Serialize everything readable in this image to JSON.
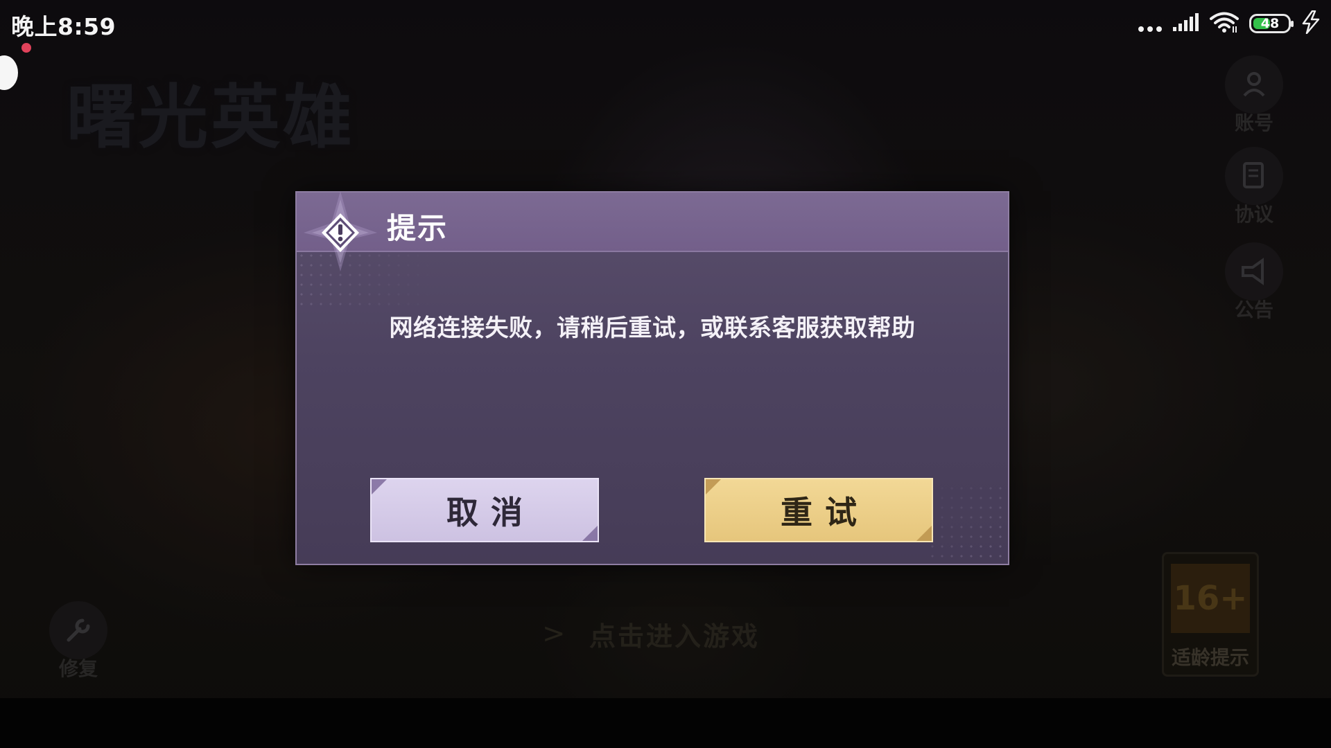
{
  "status_bar": {
    "time": "晚上8:59",
    "battery_level": "48",
    "battery_fraction": 0.48,
    "charging": true,
    "icons": [
      "more-dots-icon",
      "signal-icon",
      "wifi-icon",
      "battery-icon",
      "charging-bolt-icon"
    ]
  },
  "background": {
    "game_logo": "曙光英雄",
    "side_buttons": {
      "account": "账号",
      "agreement": "协议",
      "notice": "公告",
      "repair": "修复"
    },
    "enter_game": "点击进入游戏",
    "enter_arrow": ">",
    "age_rating": {
      "value": "16+",
      "label": "适龄提示"
    }
  },
  "dialog": {
    "title": "提示",
    "message": "网络连接失败，请稍后重试，或联系客服获取帮助",
    "buttons": {
      "cancel": "取消",
      "retry": "重试"
    }
  },
  "colors": {
    "dialog_header": "#735f8a",
    "dialog_body": "#4d4360",
    "cancel_button": "#d6cbe9",
    "retry_button": "#edcf89",
    "battery_green": "#33c14a"
  }
}
